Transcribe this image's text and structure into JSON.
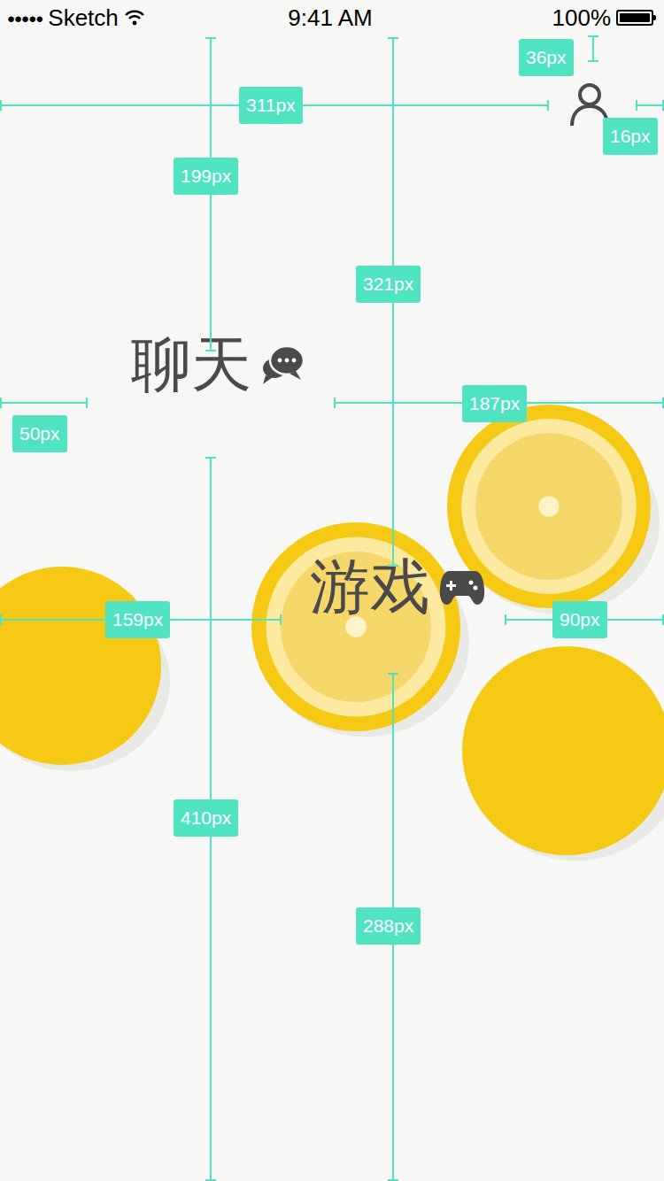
{
  "status_bar": {
    "signal": "●●●●●",
    "carrier": "Sketch",
    "time": "9:41 AM",
    "battery": "100%",
    "battery_level": 1
  },
  "menu": [
    {
      "label": "聊天",
      "kind": "chat"
    },
    {
      "label": "游戏",
      "kind": "game"
    }
  ],
  "annotations": [
    {
      "label": "36px"
    },
    {
      "label": "311px"
    },
    {
      "label": "16px"
    },
    {
      "label": "199px"
    },
    {
      "label": "321px"
    },
    {
      "label": "50px"
    },
    {
      "label": "187px"
    },
    {
      "label": "159px"
    },
    {
      "label": "90px"
    },
    {
      "label": "410px"
    },
    {
      "label": "288px"
    }
  ]
}
